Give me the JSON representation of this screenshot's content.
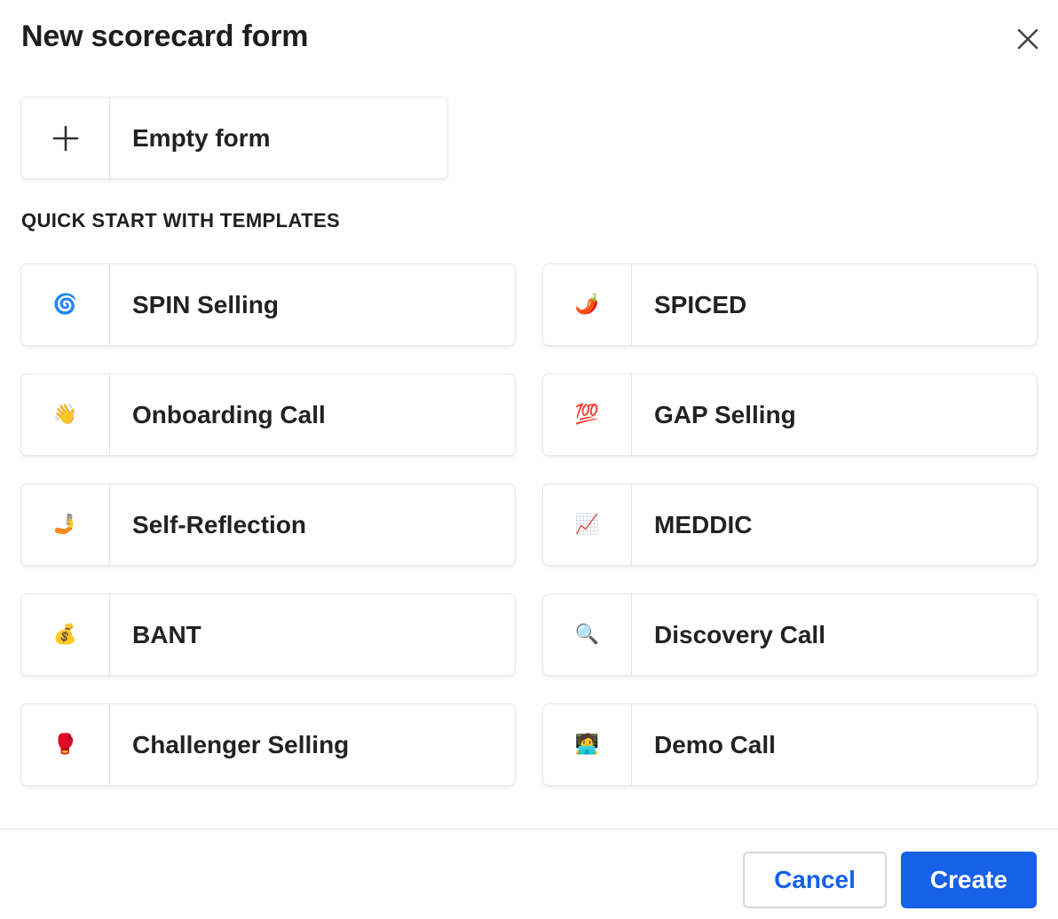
{
  "dialog": {
    "title": "New scorecard form",
    "close_icon": "close-icon"
  },
  "empty_form": {
    "icon": "plus-icon",
    "label": "Empty form"
  },
  "templates_heading": "QUICK START WITH TEMPLATES",
  "templates": [
    {
      "label": "SPIN Selling",
      "icon": "cyclone-icon",
      "emoji": "🌀"
    },
    {
      "label": "SPICED",
      "icon": "chili-pepper-icon",
      "emoji": "🌶️"
    },
    {
      "label": "Onboarding Call",
      "icon": "waving-hand-icon",
      "emoji": "👋"
    },
    {
      "label": "GAP Selling",
      "icon": "hundred-points-icon",
      "emoji": "💯"
    },
    {
      "label": "Self-Reflection",
      "icon": "mirror-icon",
      "emoji": "🤳"
    },
    {
      "label": "MEDDIC",
      "icon": "chart-increasing-icon",
      "emoji": "📈"
    },
    {
      "label": "BANT",
      "icon": "money-bag-icon",
      "emoji": "💰"
    },
    {
      "label": "Discovery Call",
      "icon": "magnifying-glass-icon",
      "emoji": "🔍"
    },
    {
      "label": "Challenger Selling",
      "icon": "boxing-glove-icon",
      "emoji": "🥊"
    },
    {
      "label": "Demo Call",
      "icon": "technologist-icon",
      "emoji": "🧑‍💻"
    }
  ],
  "footer": {
    "cancel_label": "Cancel",
    "create_label": "Create"
  },
  "colors": {
    "accent": "#1760e8",
    "border": "#e3e3e3",
    "text": "#1e1e1e"
  }
}
